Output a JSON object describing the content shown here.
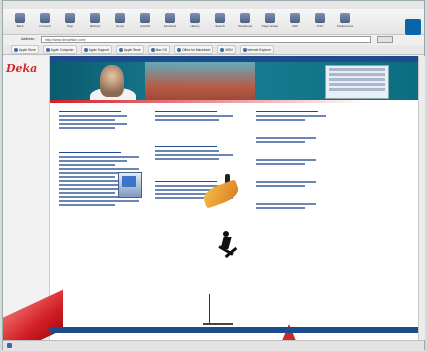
{
  "toolbar": {
    "buttons": [
      {
        "label": "Back",
        "icon": "back-arrow-icon"
      },
      {
        "label": "Forward",
        "icon": "forward-arrow-icon"
      },
      {
        "label": "Stop",
        "icon": "stop-icon"
      },
      {
        "label": "Refresh",
        "icon": "refresh-icon"
      },
      {
        "label": "Home",
        "icon": "home-icon"
      },
      {
        "label": "AutoFill",
        "icon": "autofill-icon"
      },
      {
        "label": "Favorites",
        "icon": "favorites-icon"
      },
      {
        "label": "History",
        "icon": "history-icon"
      },
      {
        "label": "Search",
        "icon": "search-icon"
      },
      {
        "label": "Scrapbook",
        "icon": "scrapbook-icon"
      },
      {
        "label": "Page Holder",
        "icon": "page-holder-icon"
      },
      {
        "label": "Mail",
        "icon": "mail-icon"
      },
      {
        "label": "Print",
        "icon": "print-icon"
      },
      {
        "label": "Preferences",
        "icon": "preferences-icon"
      }
    ]
  },
  "address": {
    "label": "Address:",
    "value": "http://www.decathlon.com/"
  },
  "bookmarks": [
    "Apple Store",
    "Apple Computer",
    "Apple Support",
    "Apple Store",
    "Mac OS",
    "Office for Macintosh",
    "MSN",
    "Internet Explorer"
  ],
  "site": {
    "brand": "Deka",
    "brand_sub": "",
    "topnav": [
      "",
      "",
      "",
      ""
    ],
    "sections": {
      "col1_title": "",
      "col1_sub": "",
      "col2_title": "",
      "col2_sub1": "",
      "col2_sub2": "",
      "col3_title": ""
    },
    "footer": [
      "",
      "",
      "",
      "",
      "",
      "",
      ""
    ]
  },
  "status": {
    "text": ""
  },
  "colors": {
    "brand_red": "#d7262e",
    "nav_blue": "#1d4b8c"
  }
}
